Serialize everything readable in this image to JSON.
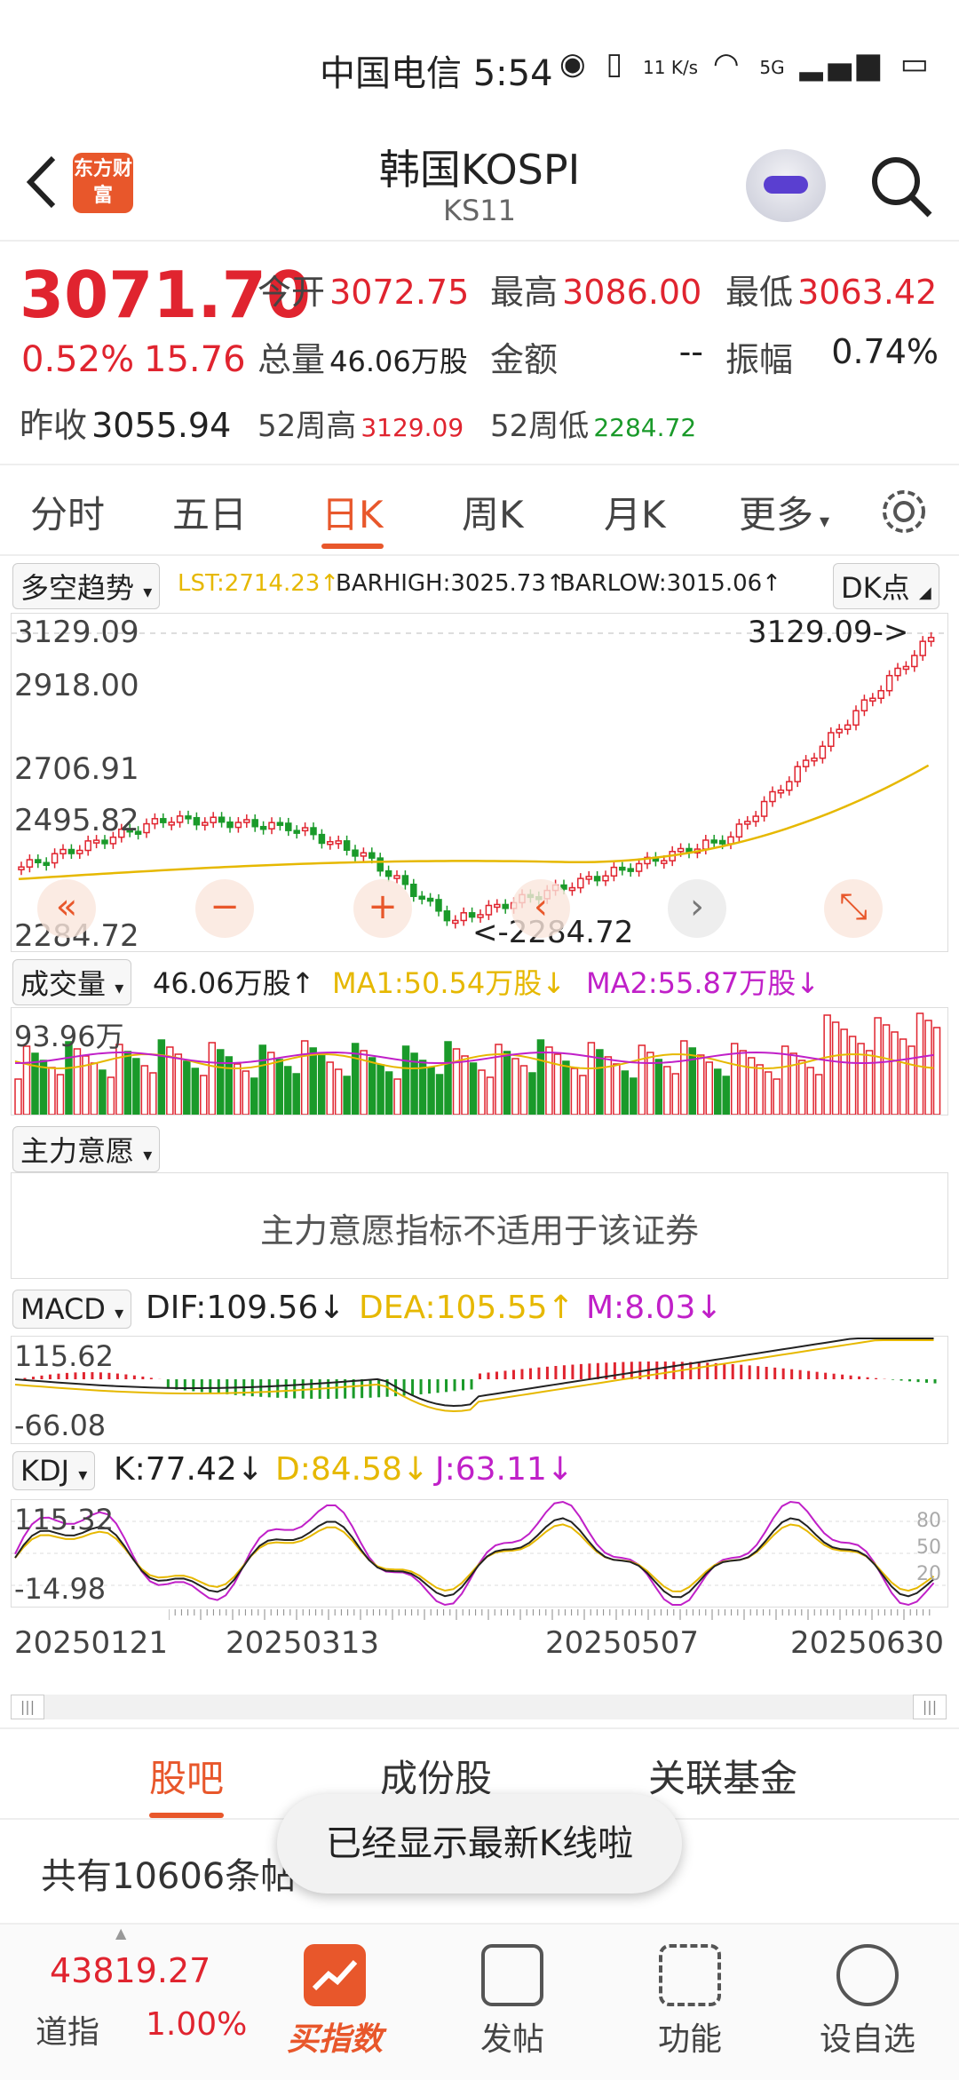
{
  "status": {
    "carrier": "中国电信 5:54",
    "net_speed": "11 K/s",
    "signal": "5G"
  },
  "header": {
    "title": "韩国KOSPI",
    "code": "KS11",
    "logo_text": "东方财富"
  },
  "quote": {
    "price": "3071.70",
    "pct": "0.52%",
    "change": "15.76",
    "prev_close_label": "昨收",
    "prev_close": "3055.94",
    "open_label": "今开",
    "open": "3072.75",
    "high_label": "最高",
    "high": "3086.00",
    "low_label": "最低",
    "low": "3063.42",
    "volume_label": "总量",
    "volume": "46.06万股",
    "amount_label": "金额",
    "amount": "--",
    "amplitude_label": "振幅",
    "amplitude": "0.74%",
    "w52_high_label": "52周高",
    "w52_high": "3129.09",
    "w52_low_label": "52周低",
    "w52_low": "2284.72"
  },
  "ktabs": [
    "分时",
    "五日",
    "日K",
    "周K",
    "月K",
    "更多"
  ],
  "chart": {
    "main_indicator": "多空趋势",
    "lst": "LST:2714.23↑",
    "barhigh": "BARHIGH:3025.73↑",
    "barlow": "BARLOW:3015.06↑",
    "dk_button": "DK点",
    "ylabels": [
      "3129.09",
      "2918.00",
      "2706.91",
      "2495.82",
      "2284.72"
    ],
    "high_marker": "3129.09->",
    "low_marker": "<-2284.72",
    "volume_indicator": "成交量",
    "volume_value": "46.06万股↑",
    "vol_ma1": "MA1:50.54万股↓",
    "vol_ma2": "MA2:55.87万股↓",
    "volume_max": "93.96万",
    "main_force": "主力意愿",
    "main_force_msg": "主力意愿指标不适用于该证券",
    "macd_indicator": "MACD",
    "dif": "DIF:109.56↓",
    "dea": "DEA:105.55↑",
    "macd_m": "M:8.03↓",
    "macd_top": "115.62",
    "macd_bottom": "-66.08",
    "kdj_indicator": "KDJ",
    "kdj_k": "K:77.42↓",
    "kdj_d": "D:84.58↓",
    "kdj_j": "J:63.11↓",
    "kdj_top": "115.32",
    "kdj_bottom": "-14.98",
    "kdj_levels": [
      "80",
      "50",
      "20"
    ],
    "dates": [
      "20250121",
      "20250313",
      "20250507",
      "20250630"
    ]
  },
  "colors": {
    "up": "#e0242f",
    "down": "#1a9a2a",
    "accent": "#e8572b",
    "ma_yellow": "#e6b800",
    "purple": "#c020c8"
  },
  "bottom_tabs": [
    "股吧",
    "成份股",
    "关联基金"
  ],
  "post_count": "共有10606条帖",
  "toast": "已经显示最新K线啦",
  "navbar": {
    "dow_value": "43819.27",
    "dow_label": "道指",
    "dow_pct": "1.00%",
    "items": [
      "买指数",
      "发帖",
      "功能",
      "设自选"
    ]
  }
}
